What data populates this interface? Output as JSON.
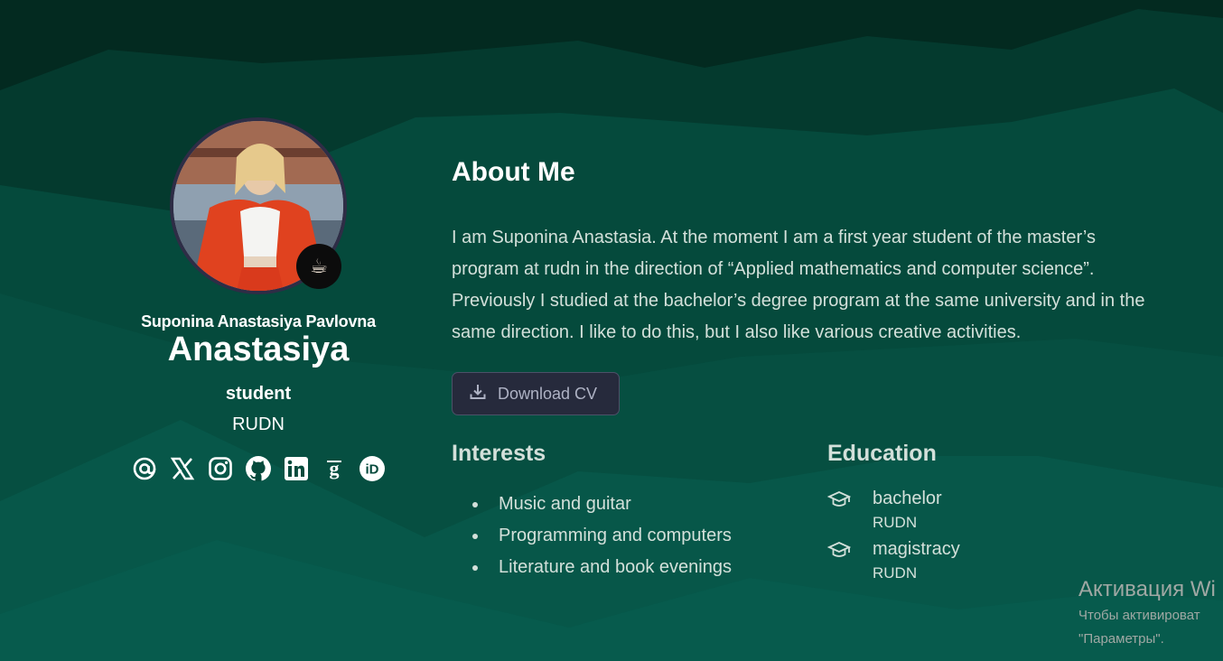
{
  "colors": {
    "bg_top": "#022a20",
    "bg_mid": "#054a3c",
    "bg_bottom": "#07584b",
    "button_bg": "#262a3c",
    "text_main": "#ffffff",
    "text_soft": "#d3e0da"
  },
  "profile": {
    "avatar_alt": "",
    "status_emoji": "☕",
    "full_name": "Suponina Anastasiya Pavlovna",
    "short_name": "Anastasiya",
    "role": "student",
    "organization": "RUDN",
    "social_icons": [
      "email-icon",
      "x-twitter-icon",
      "instagram-icon",
      "github-icon",
      "linkedin-icon",
      "google-scholar-icon",
      "orcid-icon"
    ]
  },
  "about": {
    "title": "About Me",
    "text": "I am Suponina Anastasia. At the moment I am a first year student of the master’s program at rudn in the direction of “Applied mathematics and computer science”. Previously I studied at the bachelor’s degree program at the same university and in the same direction. I like to do this, but I also like various creative activities.",
    "button_label": "Download CV",
    "button_icon": "download-icon"
  },
  "interests": {
    "title": "Interests",
    "items": [
      "Music and guitar",
      "Programming and computers",
      "Literature and book evenings"
    ]
  },
  "education": {
    "title": "Education",
    "items": [
      {
        "degree": "bachelor",
        "school": "RUDN",
        "icon": "graduation-cap-icon"
      },
      {
        "degree": "magistracy",
        "school": "RUDN",
        "icon": "graduation-cap-icon"
      }
    ]
  },
  "os_watermark": {
    "title": "Активация Wi",
    "line1": "Чтобы активироват",
    "line2": "\"Параметры\"."
  }
}
